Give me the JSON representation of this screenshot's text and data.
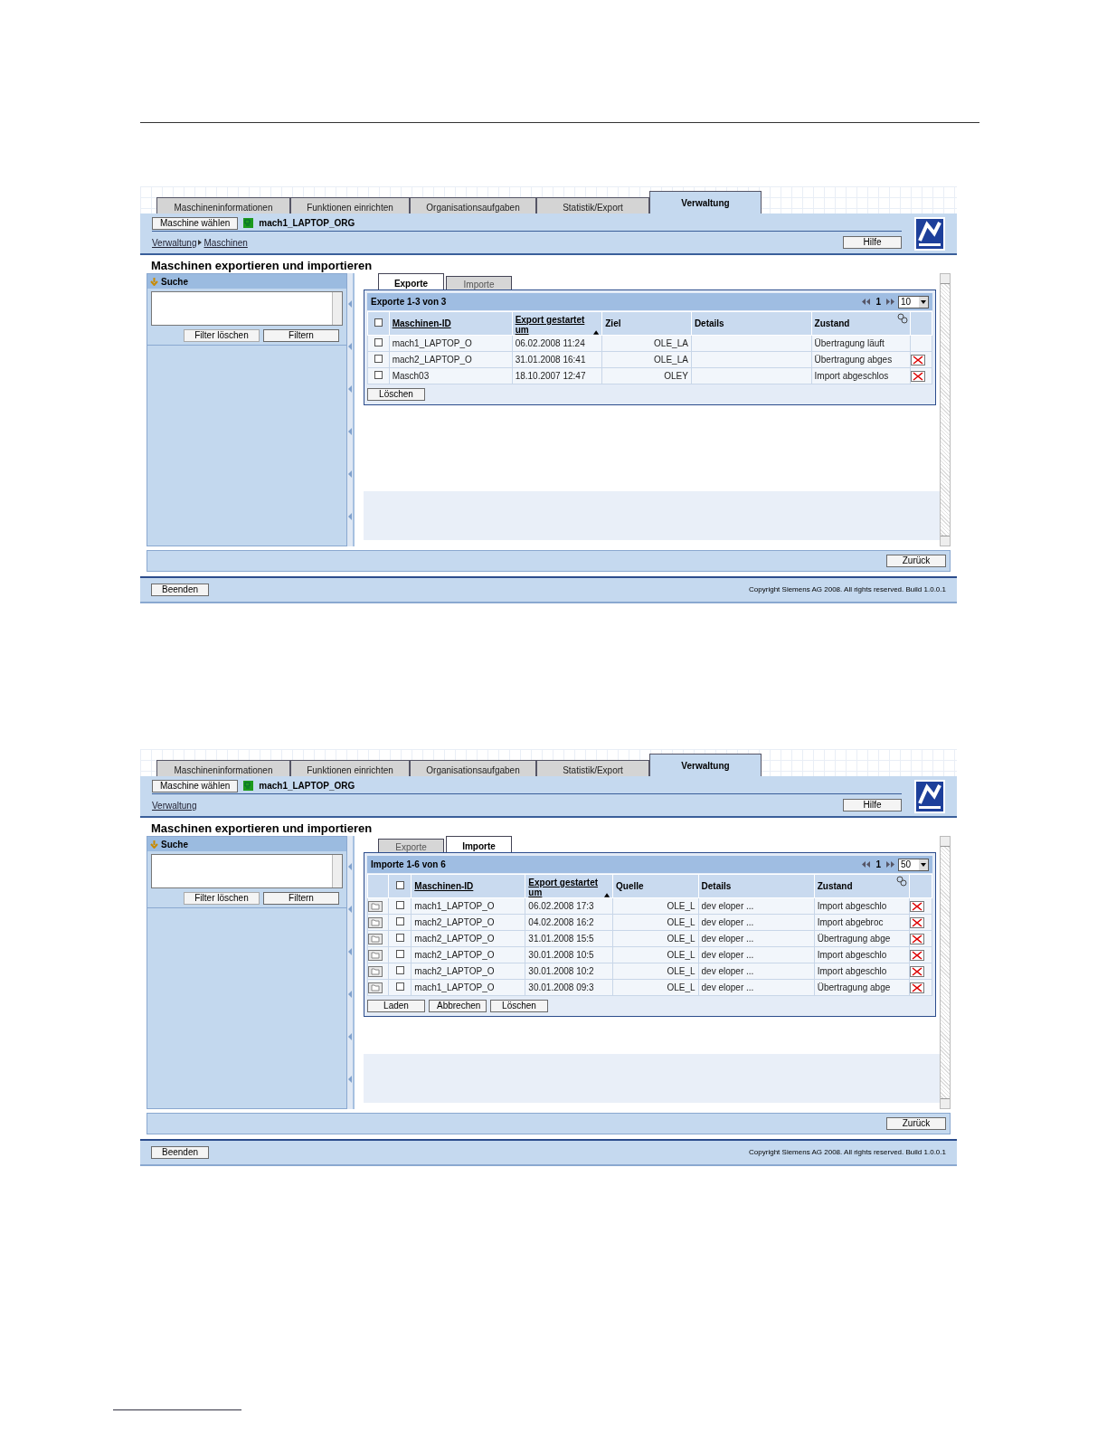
{
  "screens": [
    {
      "tabs": [
        {
          "label": "Maschineninformationen",
          "selected": false
        },
        {
          "label": "Funktionen einrichten",
          "selected": false
        },
        {
          "label": "Organisationsaufgaben",
          "selected": false
        },
        {
          "label": "Statistik/Export",
          "selected": false
        },
        {
          "label": "Verwaltung",
          "selected": true
        }
      ],
      "machine_button": "Maschine wählen",
      "machine_name": "mach1_LAPTOP_ORG",
      "breadcrumb": [
        "Verwaltung",
        "Maschinen"
      ],
      "help_button": "Hilfe",
      "page_title": "Maschinen exportieren und importieren",
      "search": {
        "title": "Suche",
        "buttons": [
          {
            "label": "Filter löschen",
            "disabled": true
          },
          {
            "label": "Filtern",
            "disabled": false
          }
        ]
      },
      "sub_tabs": [
        {
          "label": "Exporte",
          "selected": true
        },
        {
          "label": "Importe",
          "selected": false
        }
      ],
      "table": {
        "title": "Exporte 1-3 von 3",
        "page": "1",
        "page_size": "10",
        "select_all_checked": false,
        "columns": [
          {
            "label": "Maschinen-ID",
            "sortable": true,
            "sorted": false
          },
          {
            "label": "Export gestartet um",
            "sortable": true,
            "sorted": true
          },
          {
            "label": "Ziel",
            "sortable": false,
            "sorted": false
          },
          {
            "label": "Details",
            "sortable": false,
            "sorted": false
          },
          {
            "label": "Zustand",
            "sortable": false,
            "sorted": false
          }
        ],
        "rows": [
          {
            "openable": false,
            "checked": false,
            "deletable": false,
            "cells": [
              "mach1_LAPTOP_O",
              "06.02.2008 11:24",
              "OLE_LA",
              "",
              "Übertragung läuft"
            ]
          },
          {
            "openable": false,
            "checked": false,
            "deletable": true,
            "cells": [
              "mach2_LAPTOP_O",
              "31.01.2008 16:41",
              "OLE_LA",
              "",
              "Übertragung abges"
            ]
          },
          {
            "openable": false,
            "checked": false,
            "deletable": true,
            "cells": [
              "Masch03",
              "18.10.2007 12:47",
              "OLEY",
              "",
              "Import abgeschlos"
            ]
          }
        ],
        "buttons": [
          "Löschen"
        ]
      },
      "back_button": "Zurück",
      "exit_button": "Beenden",
      "copyright": "Copyright Siemens AG 2008. All rights reserved. Build 1.0.0.1"
    },
    {
      "tabs": [
        {
          "label": "Maschineninformationen",
          "selected": false
        },
        {
          "label": "Funktionen einrichten",
          "selected": false
        },
        {
          "label": "Organisationsaufgaben",
          "selected": false
        },
        {
          "label": "Statistik/Export",
          "selected": false
        },
        {
          "label": "Verwaltung",
          "selected": true
        }
      ],
      "machine_button": "Maschine wählen",
      "machine_name": "mach1_LAPTOP_ORG",
      "breadcrumb": [
        "Verwaltung"
      ],
      "help_button": "Hilfe",
      "page_title": "Maschinen exportieren und importieren",
      "search": {
        "title": "Suche",
        "buttons": [
          {
            "label": "Filter löschen",
            "disabled": true
          },
          {
            "label": "Filtern",
            "disabled": false
          }
        ]
      },
      "sub_tabs": [
        {
          "label": "Exporte",
          "selected": false
        },
        {
          "label": "Importe",
          "selected": true
        }
      ],
      "table": {
        "title": "Importe 1-6 von 6",
        "page": "1",
        "page_size": "50",
        "select_all_checked": false,
        "columns": [
          {
            "label": "Maschinen-ID",
            "sortable": true,
            "sorted": false
          },
          {
            "label": "Export gestartet um",
            "sortable": true,
            "sorted": true
          },
          {
            "label": "Quelle",
            "sortable": false,
            "sorted": false
          },
          {
            "label": "Details",
            "sortable": false,
            "sorted": false
          },
          {
            "label": "Zustand",
            "sortable": false,
            "sorted": false
          }
        ],
        "rows": [
          {
            "openable": true,
            "checked": false,
            "deletable": true,
            "cells": [
              "mach1_LAPTOP_O",
              "06.02.2008 17:3",
              "OLE_L",
              "dev eloper ...",
              "Import abgeschlo"
            ]
          },
          {
            "openable": true,
            "checked": false,
            "deletable": true,
            "cells": [
              "mach2_LAPTOP_O",
              "04.02.2008 16:2",
              "OLE_L",
              "dev eloper ...",
              "Import abgebroc"
            ]
          },
          {
            "openable": true,
            "checked": false,
            "deletable": true,
            "cells": [
              "mach2_LAPTOP_O",
              "31.01.2008 15:5",
              "OLE_L",
              "dev eloper ...",
              "Übertragung abge"
            ]
          },
          {
            "openable": true,
            "checked": false,
            "deletable": true,
            "cells": [
              "mach2_LAPTOP_O",
              "30.01.2008 10:5",
              "OLE_L",
              "dev eloper ...",
              "Import abgeschlo"
            ]
          },
          {
            "openable": true,
            "checked": false,
            "deletable": true,
            "cells": [
              "mach2_LAPTOP_O",
              "30.01.2008 10:2",
              "OLE_L",
              "dev eloper ...",
              "Import abgeschlo"
            ]
          },
          {
            "openable": true,
            "checked": false,
            "deletable": true,
            "cells": [
              "mach1_LAPTOP_O",
              "30.01.2008 09:3",
              "OLE_L",
              "dev eloper ...",
              "Übertragung abge"
            ]
          }
        ],
        "buttons": [
          "Laden",
          "Abbrechen",
          "Löschen"
        ]
      },
      "back_button": "Zurück",
      "exit_button": "Beenden",
      "copyright": "Copyright Siemens AG 2008. All rights reserved. Build 1.0.0.1"
    }
  ]
}
